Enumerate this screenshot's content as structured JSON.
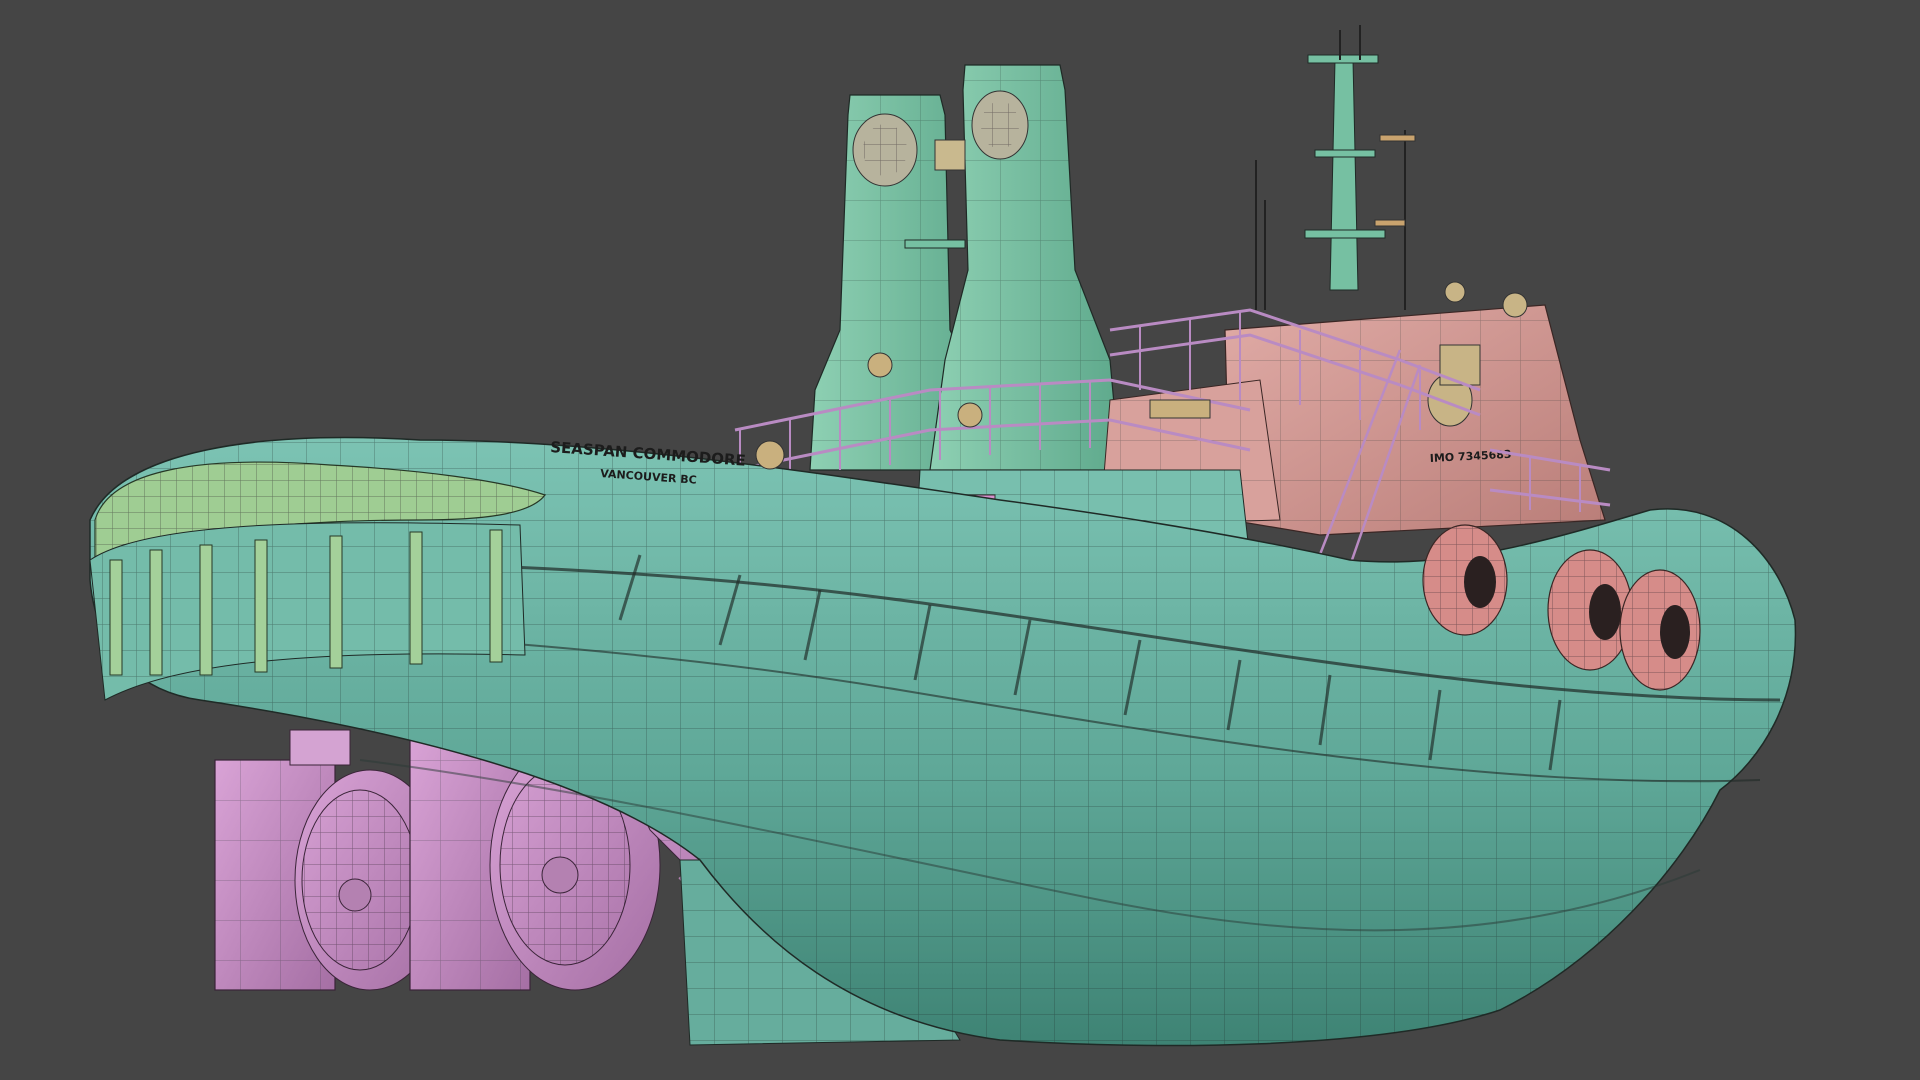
{
  "scene": {
    "background_color": "#454545",
    "colors": {
      "hull": "#6fb5a5",
      "hull_shadow": "#3f7f71",
      "fender": "#9cc990",
      "stack": "#79c3a3",
      "superstructure": "#d49a95",
      "thruster": "#c98fc7",
      "railing": "#b98bc3",
      "tire": "#d78c8a",
      "wire": "#1f2a26"
    }
  },
  "hull_text": {
    "vessel_name": "SEASPAN COMMODORE",
    "home_port": "VANCOUVER BC",
    "imo_number": "IMO 7345683"
  }
}
